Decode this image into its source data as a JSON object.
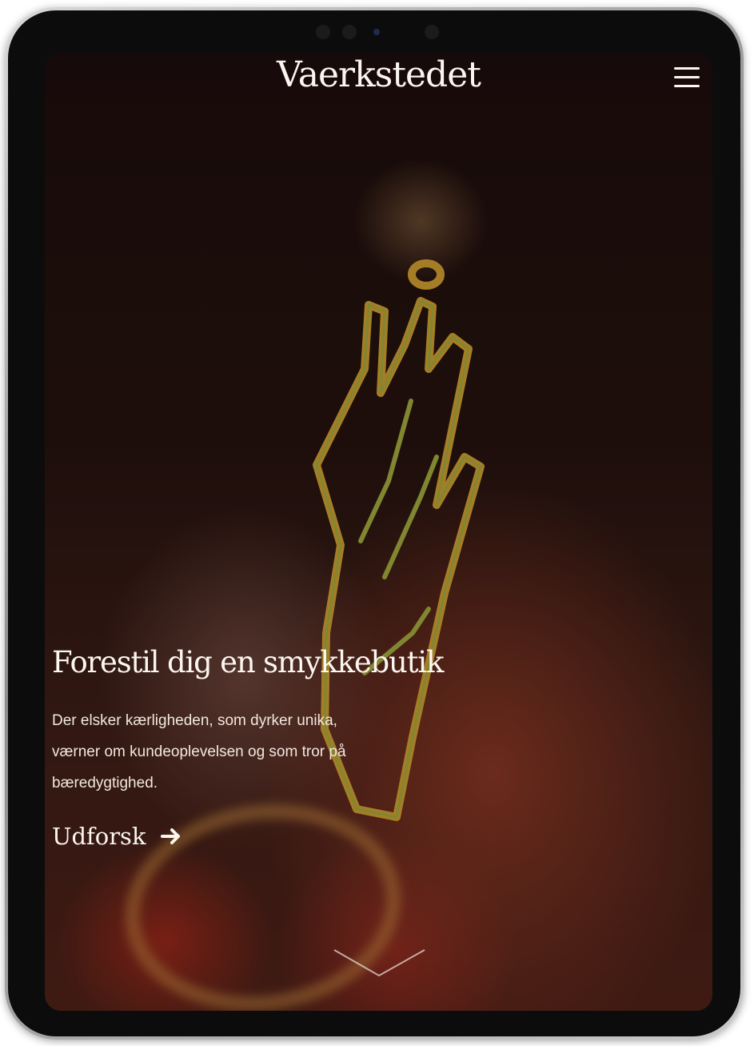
{
  "header": {
    "brand": "Vaerkstedet",
    "menu_icon": "hamburger-menu-icon"
  },
  "hero": {
    "headline": "Forestil dig en smykkebutik",
    "description": "Der elsker kærligheden, som dyrker unika, værner om kundeoplevelsen og som tror på bæredygtighed.",
    "cta_label": "Udforsk",
    "cta_icon": "arrow-right-icon",
    "scroll_icon": "chevron-down-icon"
  },
  "colors": {
    "text": "#fbf6ef",
    "gold_outline": "#9aa43a",
    "gold_fill": "#c8982f"
  }
}
